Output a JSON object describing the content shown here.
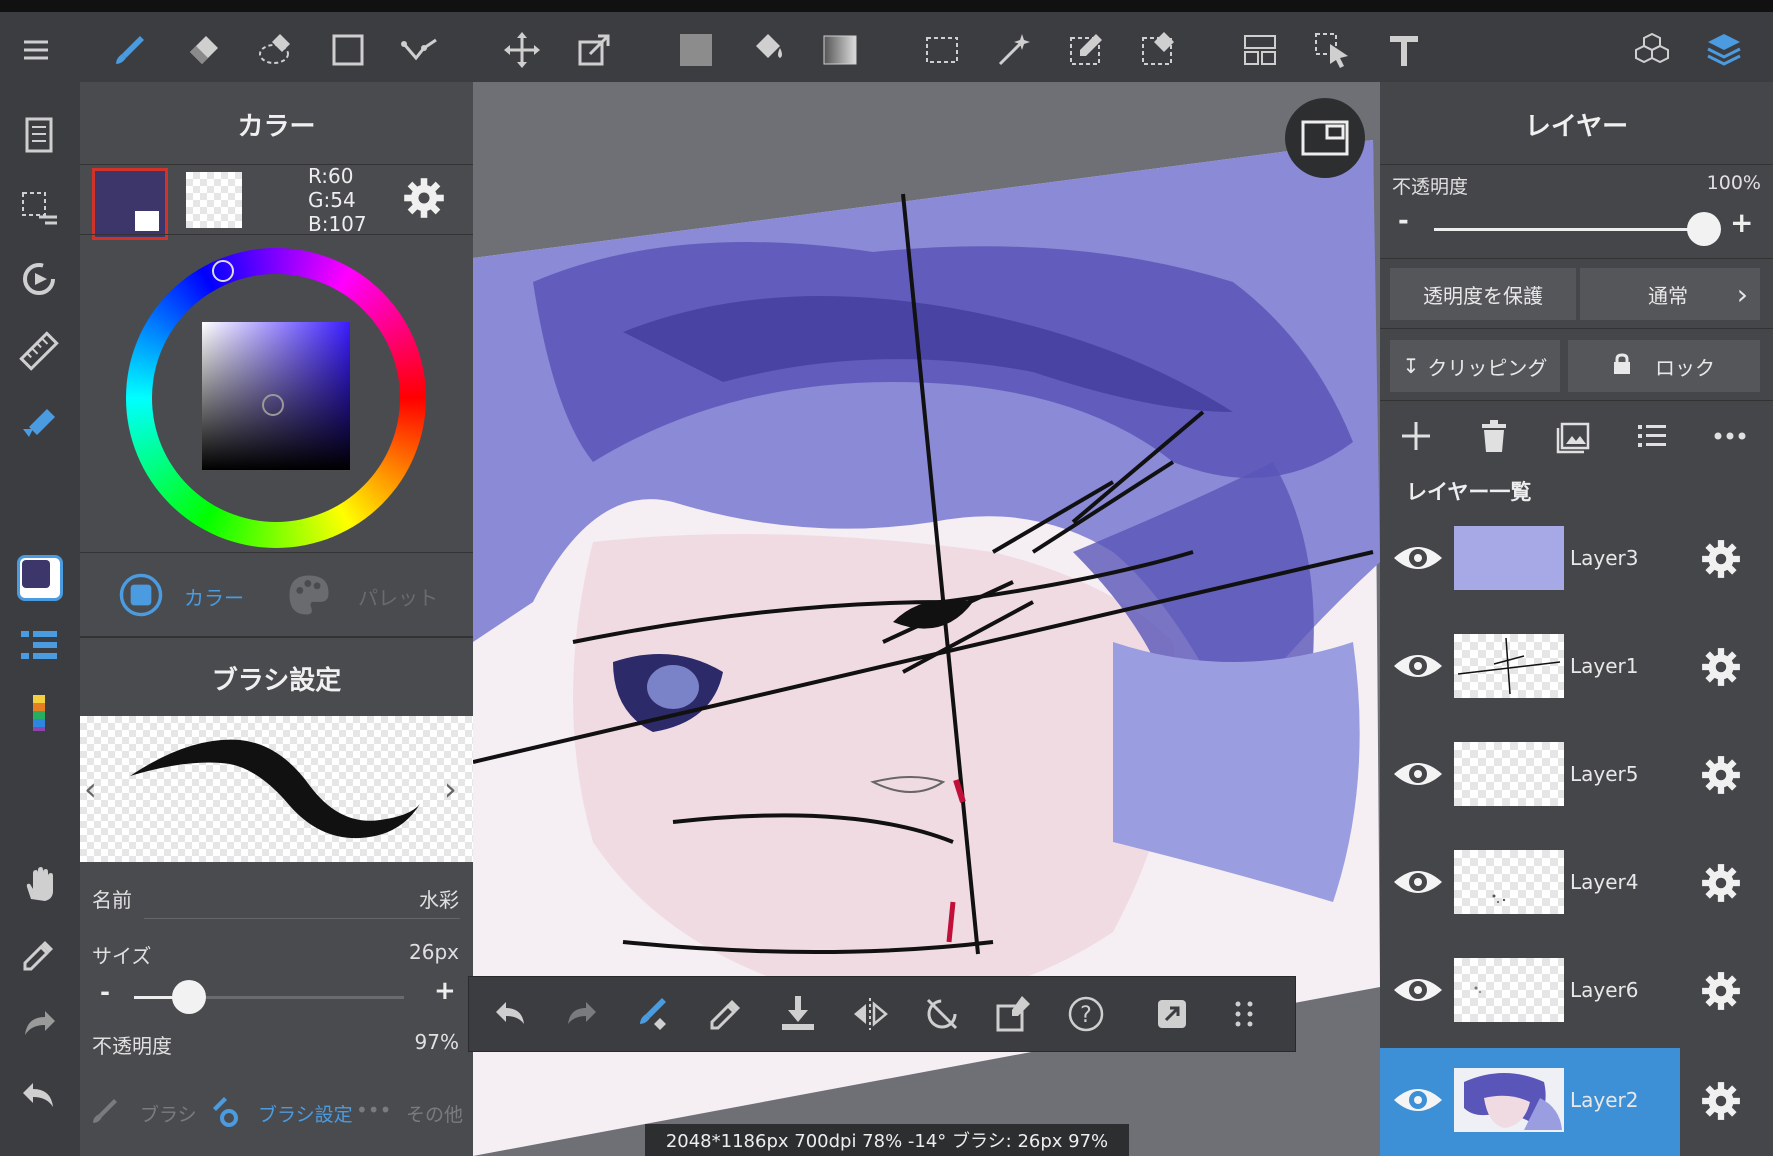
{
  "color_panel": {
    "title": "カラー",
    "rgb_r": "R:60",
    "rgb_g": "G:54",
    "rgb_b": "B:107",
    "current_color": "#3c366b",
    "tab_color": "カラー",
    "tab_palette": "パレット"
  },
  "brush_panel": {
    "title": "ブラシ設定",
    "name_label": "名前",
    "name_value": "水彩",
    "size_label": "サイズ",
    "size_value": "26px",
    "size_level": 0.2,
    "opacity_label": "不透明度",
    "opacity_value": "97%",
    "tab_brush": "ブラシ",
    "tab_brush_settings": "ブラシ設定",
    "tab_other": "その他",
    "minus": "-",
    "plus": "+"
  },
  "layer_panel": {
    "title": "レイヤー",
    "opacity_label": "不透明度",
    "opacity_value": "100%",
    "opacity_level": 1.0,
    "minus": "-",
    "plus": "+",
    "protect_alpha": "透明度を保護",
    "blend_mode": "通常",
    "clipping": "クリッピング",
    "lock": "ロック",
    "list_heading": "レイヤー一覧",
    "layers": [
      {
        "name": "Layer3",
        "selected": false
      },
      {
        "name": "Layer1",
        "selected": false
      },
      {
        "name": "Layer5",
        "selected": false
      },
      {
        "name": "Layer4",
        "selected": false
      },
      {
        "name": "Layer6",
        "selected": false
      },
      {
        "name": "Layer2",
        "selected": true
      }
    ]
  },
  "status_text": "2048*1186px 700dpi 78% -14° ブラシ: 26px 97%",
  "colors": {
    "accent": "#4a9be0",
    "toolbar_bg": "#3c3d40",
    "panel_bg": "#4a4b4f",
    "selected_layer_bg": "#3d8fd6"
  }
}
